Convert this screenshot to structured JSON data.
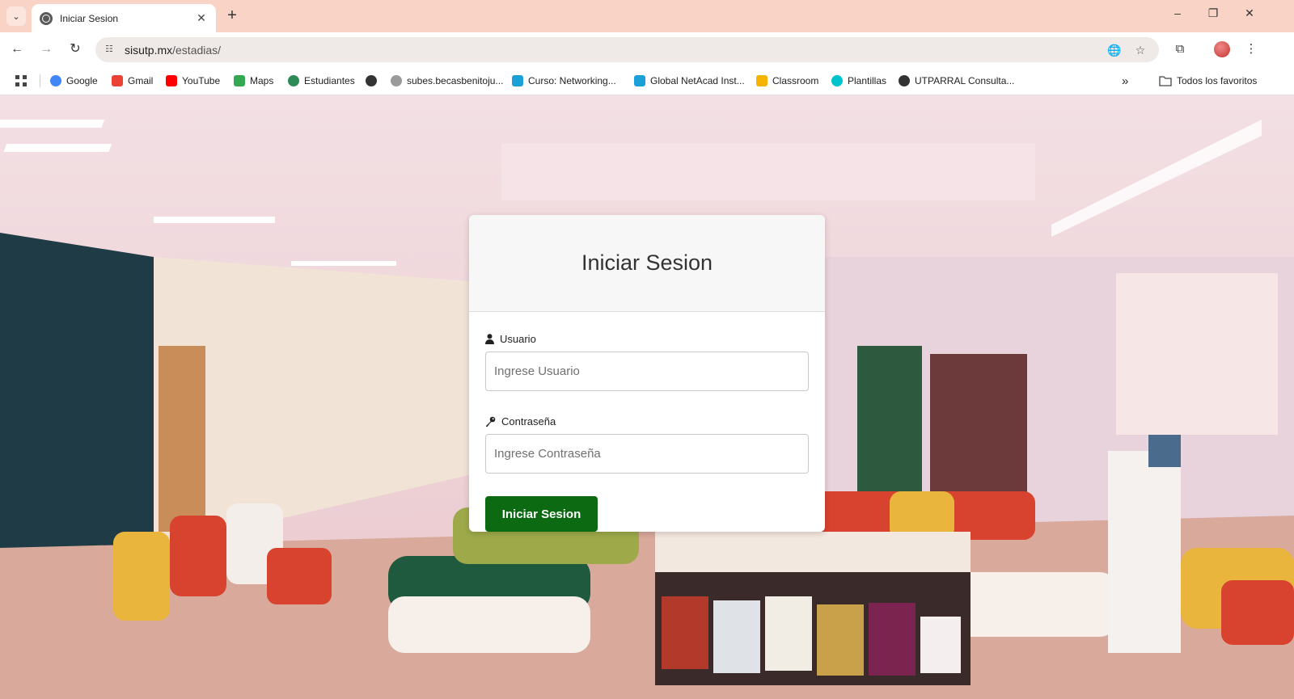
{
  "browser": {
    "tab_title": "Iniciar Sesion",
    "url_host": "sisutp.mx",
    "url_path": "/estadias/",
    "bookmarks": [
      {
        "label": "Google",
        "icon": "google-icon",
        "color": "#4285f4"
      },
      {
        "label": "Gmail",
        "icon": "gmail-icon",
        "color": "#ea4335"
      },
      {
        "label": "YouTube",
        "icon": "youtube-icon",
        "color": "#ff0000"
      },
      {
        "label": "Maps",
        "icon": "maps-icon",
        "color": "#34a853"
      },
      {
        "label": "Estudiantes",
        "icon": "students-icon",
        "color": "#2e8b57"
      },
      {
        "label": "",
        "icon": "globe-icon",
        "color": "#333333"
      },
      {
        "label": "subes.becasbenitoju...",
        "icon": "seal-icon",
        "color": "#9a9a9a"
      },
      {
        "label": "Curso: Networking...",
        "icon": "cisco-icon",
        "color": "#1ba0d7"
      },
      {
        "label": "Global NetAcad Inst...",
        "icon": "cisco-icon",
        "color": "#1ba0d7"
      },
      {
        "label": "Classroom",
        "icon": "classroom-icon",
        "color": "#f4b400"
      },
      {
        "label": "Plantillas",
        "icon": "canva-icon",
        "color": "#00c4cc"
      },
      {
        "label": "UTPARRAL Consulta...",
        "icon": "globe-icon",
        "color": "#333333"
      }
    ],
    "all_bookmarks_label": "Todos los favoritos"
  },
  "login": {
    "title": "Iniciar Sesion",
    "user_label": "Usuario",
    "user_placeholder": "Ingrese Usuario",
    "password_label": "Contraseña",
    "password_placeholder": "Ingrese Contraseña",
    "submit_label": "Iniciar Sesion",
    "submit_color": "#0c6b12"
  }
}
